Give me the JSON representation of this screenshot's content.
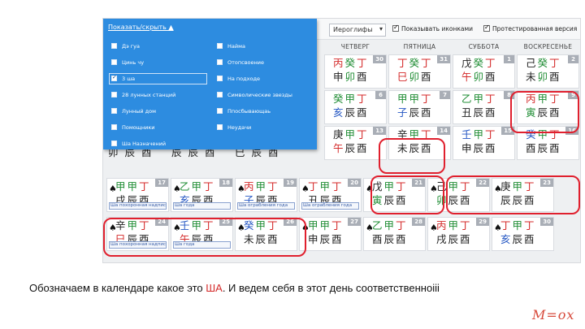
{
  "toolbar": {
    "select_value": "Иероглифы",
    "check_icons": "Показывать иконками",
    "check_test": "Протестированная версия"
  },
  "menu": {
    "toggle_label": "Показать/скрыть ▲",
    "left": [
      "Дэ гуа",
      "Цинь чу",
      "3 ша",
      "28 лунных станций",
      "Лунный дом",
      "Помощники",
      "Ша Назначений"
    ],
    "right": [
      "Найма",
      "Отопсвоение",
      "На подходе",
      "Символические звезды",
      "Ппосбывающаь",
      "Неудачи"
    ]
  },
  "days": [
    "ЧЕТВЕРГ",
    "ПЯТНИЦА",
    "СУББОТА",
    "ВОСКРЕСЕНЬЕ"
  ],
  "cells": [
    {
      "num": "30",
      "r1": [
        "丙",
        "癸",
        "丁"
      ],
      "r2": [
        "申",
        "卯",
        "酉"
      ],
      "c1": [
        "red",
        "green",
        "red"
      ],
      "c2": [
        "dark",
        "green",
        "dark"
      ]
    },
    {
      "num": "31",
      "r1": [
        "丁",
        "癸",
        "丁"
      ],
      "r2": [
        "巳",
        "卯",
        "酉"
      ],
      "c1": [
        "red",
        "green",
        "red"
      ],
      "c2": [
        "red",
        "green",
        "dark"
      ]
    },
    {
      "num": "1",
      "r1": [
        "戊",
        "癸",
        "丁"
      ],
      "r2": [
        "午",
        "卯",
        "酉"
      ],
      "c1": [
        "dark",
        "green",
        "red"
      ],
      "c2": [
        "red",
        "green",
        "dark"
      ]
    },
    {
      "num": "2",
      "r1": [
        "己",
        "癸",
        "丁"
      ],
      "r2": [
        "未",
        "卯",
        "酉"
      ],
      "c1": [
        "dark",
        "green",
        "red"
      ],
      "c2": [
        "dark",
        "green",
        "dark"
      ]
    },
    {
      "num": "6",
      "r1": [
        "癸",
        "甲",
        "丁"
      ],
      "r2": [
        "亥",
        "辰",
        "酉"
      ],
      "c1": [
        "green",
        "green",
        "red"
      ],
      "c2": [
        "blue",
        "dark",
        "dark"
      ]
    },
    {
      "num": "7",
      "r1": [
        "甲",
        "甲",
        "丁"
      ],
      "r2": [
        "子",
        "辰",
        "酉"
      ],
      "c1": [
        "green",
        "green",
        "red"
      ],
      "c2": [
        "blue",
        "dark",
        "dark"
      ]
    },
    {
      "num": "8",
      "r1": [
        "乙",
        "甲",
        "丁"
      ],
      "r2": [
        "丑",
        "辰",
        "酉"
      ],
      "c1": [
        "green",
        "green",
        "red"
      ],
      "c2": [
        "dark",
        "dark",
        "dark"
      ]
    },
    {
      "num": "9",
      "r1": [
        "丙",
        "甲",
        "丁"
      ],
      "r2": [
        "寅",
        "辰",
        "酉"
      ],
      "c1": [
        "red",
        "green",
        "red"
      ],
      "c2": [
        "green",
        "dark",
        "dark"
      ]
    },
    {
      "num": "13",
      "r1": [
        "庚",
        "甲",
        "丁"
      ],
      "r2": [
        "午",
        "辰",
        "酉"
      ],
      "c1": [
        "dark",
        "green",
        "red"
      ],
      "c2": [
        "red",
        "dark",
        "dark"
      ]
    },
    {
      "num": "14",
      "r1": [
        "辛",
        "甲",
        "丁"
      ],
      "r2": [
        "未",
        "辰",
        "酉"
      ],
      "c1": [
        "dark",
        "green",
        "red"
      ],
      "c2": [
        "dark",
        "dark",
        "dark"
      ]
    },
    {
      "num": "15",
      "r1": [
        "壬",
        "甲",
        "丁"
      ],
      "r2": [
        "申",
        "辰",
        "酉"
      ],
      "c1": [
        "blue",
        "green",
        "red"
      ],
      "c2": [
        "dark",
        "dark",
        "dark"
      ]
    },
    {
      "num": "16",
      "r1": [
        "癸",
        "甲",
        "丁"
      ],
      "r2": [
        "酉",
        "辰",
        "酉"
      ],
      "c1": [
        "blue",
        "green",
        "red"
      ],
      "c2": [
        "dark",
        "dark",
        "dark"
      ]
    },
    {
      "num": "17",
      "r1": [
        "甲",
        "甲",
        "丁"
      ],
      "r2": [
        "戌",
        "辰",
        "酉"
      ],
      "c1": [
        "green",
        "green",
        "red"
      ],
      "c2": [
        "dark",
        "dark",
        "dark"
      ]
    },
    {
      "num": "18",
      "r1": [
        "乙",
        "甲",
        "丁"
      ],
      "r2": [
        "亥",
        "辰",
        "酉"
      ],
      "c1": [
        "green",
        "green",
        "red"
      ],
      "c2": [
        "blue",
        "dark",
        "dark"
      ]
    },
    {
      "num": "19",
      "r1": [
        "丙",
        "甲",
        "丁"
      ],
      "r2": [
        "子",
        "辰",
        "酉"
      ],
      "c1": [
        "red",
        "green",
        "red"
      ],
      "c2": [
        "blue",
        "dark",
        "dark"
      ]
    },
    {
      "num": "20",
      "r1": [
        "丁",
        "甲",
        "丁"
      ],
      "r2": [
        "丑",
        "辰",
        "酉"
      ],
      "c1": [
        "red",
        "green",
        "red"
      ],
      "c2": [
        "dark",
        "dark",
        "dark"
      ]
    },
    {
      "num": "21",
      "r1": [
        "戊",
        "甲",
        "丁"
      ],
      "r2": [
        "寅",
        "辰",
        "酉"
      ],
      "c1": [
        "dark",
        "green",
        "red"
      ],
      "c2": [
        "green",
        "dark",
        "dark"
      ]
    },
    {
      "num": "22",
      "r1": [
        "己",
        "甲",
        "丁"
      ],
      "r2": [
        "卯",
        "辰",
        "酉"
      ],
      "c1": [
        "dark",
        "green",
        "red"
      ],
      "c2": [
        "green",
        "dark",
        "dark"
      ]
    },
    {
      "num": "23",
      "r1": [
        "庚",
        "甲",
        "丁"
      ],
      "r2": [
        "辰",
        "辰",
        "酉"
      ],
      "c1": [
        "dark",
        "green",
        "red"
      ],
      "c2": [
        "dark",
        "dark",
        "dark"
      ]
    },
    {
      "num": "24",
      "r1": [
        "辛",
        "甲",
        "丁"
      ],
      "r2": [
        "巳",
        "辰",
        "酉"
      ],
      "c1": [
        "dark",
        "green",
        "red"
      ],
      "c2": [
        "red",
        "dark",
        "dark"
      ]
    },
    {
      "num": "25",
      "r1": [
        "壬",
        "甲",
        "丁"
      ],
      "r2": [
        "午",
        "辰",
        "酉"
      ],
      "c1": [
        "blue",
        "green",
        "red"
      ],
      "c2": [
        "red",
        "dark",
        "dark"
      ]
    },
    {
      "num": "26",
      "r1": [
        "癸",
        "甲",
        "丁"
      ],
      "r2": [
        "未",
        "辰",
        "酉"
      ],
      "c1": [
        "blue",
        "green",
        "red"
      ],
      "c2": [
        "dark",
        "dark",
        "dark"
      ]
    },
    {
      "num": "27",
      "r1": [
        "甲",
        "甲",
        "丁"
      ],
      "r2": [
        "申",
        "辰",
        "酉"
      ],
      "c1": [
        "green",
        "green",
        "red"
      ],
      "c2": [
        "dark",
        "dark",
        "dark"
      ]
    },
    {
      "num": "28",
      "r1": [
        "乙",
        "甲",
        "丁"
      ],
      "r2": [
        "酉",
        "辰",
        "酉"
      ],
      "c1": [
        "green",
        "green",
        "red"
      ],
      "c2": [
        "dark",
        "dark",
        "dark"
      ]
    },
    {
      "num": "29",
      "r1": [
        "丙",
        "甲",
        "丁"
      ],
      "r2": [
        "戌",
        "辰",
        "酉"
      ],
      "c1": [
        "red",
        "green",
        "red"
      ],
      "c2": [
        "dark",
        "dark",
        "dark"
      ]
    },
    {
      "num": "30",
      "r1": [
        "丁",
        "甲",
        "丁"
      ],
      "r2": [
        "亥",
        "辰",
        "酉"
      ],
      "c1": [
        "red",
        "green",
        "red"
      ],
      "c2": [
        "blue",
        "dark",
        "dark"
      ]
    }
  ],
  "partial_row": [
    "卯 辰 酉",
    "辰 辰 酉",
    "巳 辰 酉"
  ],
  "note_labels": [
    "Ша похоронная надпись",
    "Ша года",
    "Ша ограбления года",
    "Ша ограбления года",
    "Ша похоронная надпись",
    "Ша года"
  ],
  "caption": {
    "before": "Обозначаем в календаре какое это ",
    "highlight": "ША",
    "after": ". И ведем себя в этот день соответственноiii"
  },
  "logo": "M=ox"
}
